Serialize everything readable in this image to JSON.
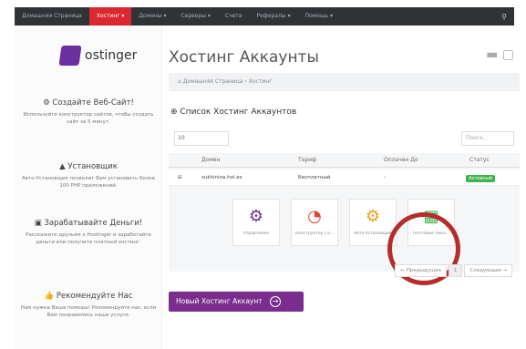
{
  "nav": {
    "items": [
      "Домашняя Страница",
      "Хостинг ▾",
      "Домены ▾",
      "Серверы ▾",
      "Счета",
      "Рефералы ▾",
      "Помощь ▾"
    ],
    "active_index": 1,
    "search_icon": "search-icon"
  },
  "sidebar": {
    "logo_text": "ostinger",
    "blocks": [
      {
        "title": "Создайте Веб-Сайт!",
        "icon": "gears-icon",
        "text": "Используйте конструктор сайтов, чтобы создать сайт за 5 минут."
      },
      {
        "title": "Установщик",
        "icon": "installer-icon",
        "text": "Авто-Установщик позволит Вам установить более 100 PHP приложений."
      },
      {
        "title": "Зарабатывайте Деньги!",
        "icon": "money-icon",
        "text": "Расскажите друзьям о Hostinger и заработайте деньги или получите платный хостинг."
      },
      {
        "title": "Рекомендуйте Нас",
        "icon": "thumbs-up-icon",
        "text": "Нам нужна Ваша помощь! Рекомендуйте нас, если Вам понравились наши услуги."
      }
    ]
  },
  "main": {
    "title": "Хостинг Аккаунты",
    "breadcrumb": "⌂ Домашняя Страница  ›  Хостинг",
    "section_title": "⊕ Список Хостинг Аккаунтов",
    "page_length": "10",
    "search_placeholder": "Поиск...",
    "columns": [
      "Домен",
      "Тариф",
      "Оплачен До",
      "Статус"
    ],
    "row": {
      "domain": "sukhinina.hol.es",
      "plan": "Бесплатный",
      "paid_until": "-",
      "status": "Активный"
    },
    "tiles": [
      {
        "label": "Управление",
        "icon": "gear-icon",
        "color": "#6b2fa0"
      },
      {
        "label": "Конструктор Са...",
        "icon": "builder-icon",
        "color": "#e0452b"
      },
      {
        "label": "Авто-Установщик",
        "icon": "installer-icon",
        "color": "#f29a1a"
      },
      {
        "label": "Почтовые Акка...",
        "icon": "mail-icon",
        "color": "#3fb34f"
      }
    ],
    "pager": {
      "prev": "← Предыдущая",
      "current": "1",
      "next": "Следующая →"
    },
    "cta": "Новый Хостинг Аккаунт"
  },
  "colors": {
    "accent": "#7b2d8d",
    "active_nav": "#d9282f",
    "status_green": "#3fb34f",
    "highlight_ring": "#b72b2b"
  }
}
